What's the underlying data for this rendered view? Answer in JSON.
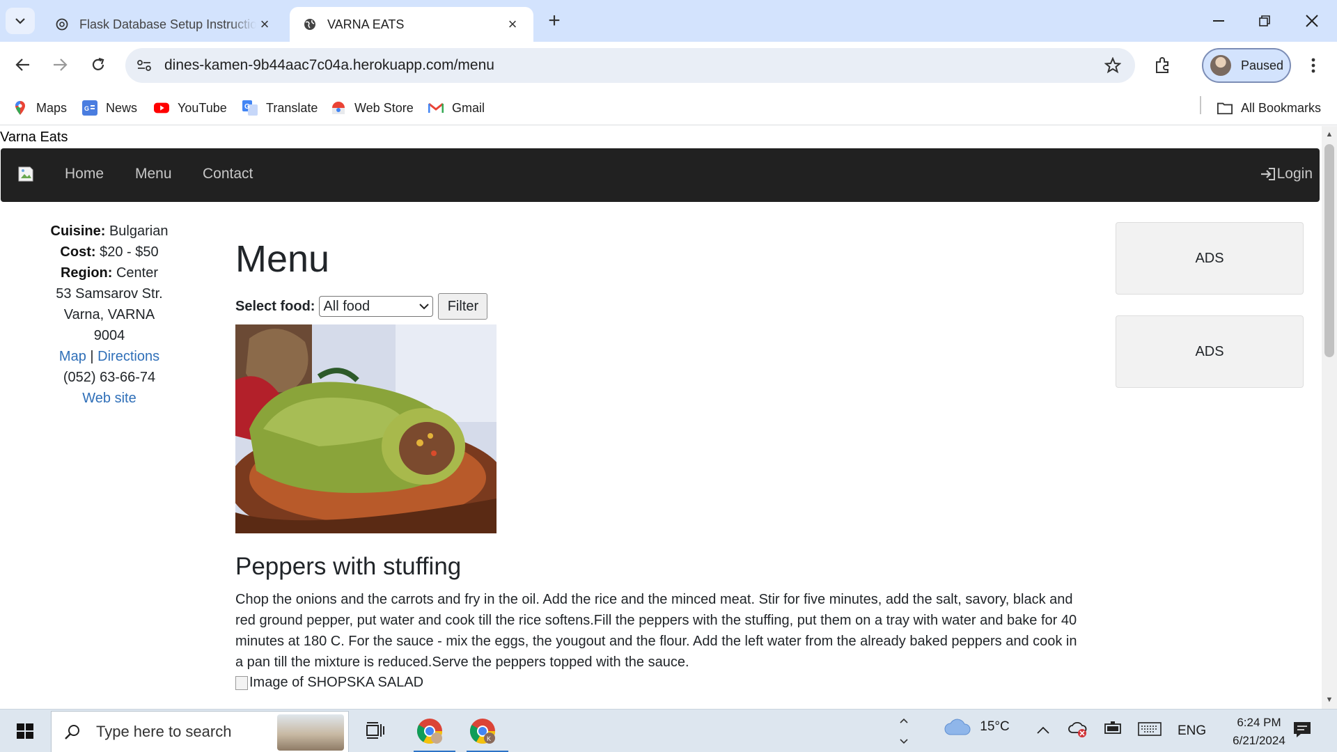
{
  "browser": {
    "tabs": [
      {
        "title": "Flask Database Setup Instructio",
        "icon": "openai-icon"
      },
      {
        "title": "VARNA EATS",
        "icon": "globe-icon"
      }
    ],
    "url": "dines-kamen-9b44aac7c04a.herokuapp.com/menu",
    "profile_label": "Paused",
    "bookmarks": [
      {
        "label": "Maps",
        "icon": "maps-icon"
      },
      {
        "label": "News",
        "icon": "news-icon"
      },
      {
        "label": "YouTube",
        "icon": "youtube-icon"
      },
      {
        "label": "Translate",
        "icon": "translate-icon"
      },
      {
        "label": "Web Store",
        "icon": "webstore-icon"
      },
      {
        "label": "Gmail",
        "icon": "gmail-icon"
      }
    ],
    "all_bookmarks_label": "All Bookmarks"
  },
  "page": {
    "site_title": "Varna Eats",
    "nav": {
      "links": [
        "Home",
        "Menu",
        "Contact"
      ],
      "login_label": "Login"
    },
    "info": {
      "cuisine_label": "Cuisine:",
      "cuisine": "Bulgarian",
      "cost_label": "Cost:",
      "cost": "$20 - $50",
      "region_label": "Region:",
      "region": "Center",
      "street": "53 Samsarov Str.",
      "city": "Varna, VARNA",
      "zip": "9004",
      "map_link": "Map",
      "separator": "|",
      "directions_link": "Directions",
      "phone": "(052) 63-66-74",
      "website_link": "Web site"
    },
    "heading": "Menu",
    "filter": {
      "label": "Select food:",
      "selected": "All food",
      "button": "Filter"
    },
    "dish": {
      "title": "Peppers with stuffing",
      "description": "Chop the onions and the carrots and fry in the oil. Add the rice and the minced meat. Stir for five minutes, add the salt, savory, black and red ground pepper, put water and cook till the rice softens.Fill the peppers with the stuffing, put them on a tray with water and bake for 40 minutes at 180 C. For the sauce - mix the eggs, the yougout and the flour. Add the left water from the already baked peppers and cook in a pan till the mixture is reduced.Serve the peppers topped with the sauce."
    },
    "next_image_alt": "Image of SHOPSKA SALAD",
    "ads": [
      "ADS",
      "ADS"
    ]
  },
  "taskbar": {
    "search_placeholder": "Type here to search",
    "weather": "15°C",
    "language": "ENG",
    "time": "6:24 PM",
    "date": "6/21/2024"
  }
}
